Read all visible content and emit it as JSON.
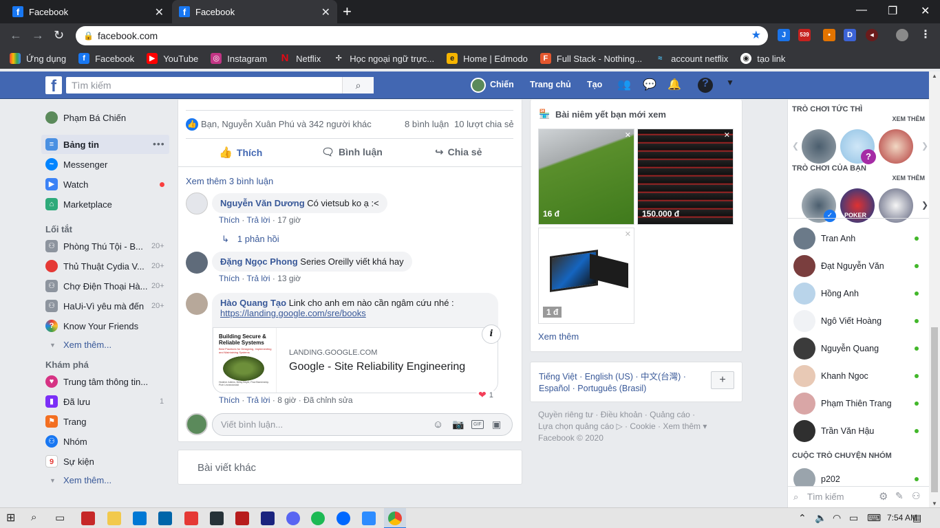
{
  "browser": {
    "tabs": [
      {
        "title": "Facebook"
      },
      {
        "title": "Facebook"
      }
    ],
    "url": "facebook.com",
    "bookmarks": [
      {
        "label": "Ứng dụng"
      },
      {
        "label": "Facebook"
      },
      {
        "label": "YouTube"
      },
      {
        "label": "Instagram"
      },
      {
        "label": "Netflix"
      },
      {
        "label": "Học ngoại ngữ trực..."
      },
      {
        "label": "Home | Edmodo"
      },
      {
        "label": "Full Stack - Nothing..."
      },
      {
        "label": "account netflix"
      },
      {
        "label": "tạo link"
      }
    ],
    "ext_badge": "539",
    "ext_d": "D"
  },
  "header": {
    "search_placeholder": "Tìm kiếm",
    "user": "Chiến",
    "home": "Trang chủ",
    "create": "Tạo"
  },
  "left": {
    "profile": "Phạm Bá Chiến",
    "main": [
      {
        "label": "Bảng tin"
      },
      {
        "label": "Messenger"
      },
      {
        "label": "Watch"
      },
      {
        "label": "Marketplace"
      }
    ],
    "shortcuts_title": "Lối tắt",
    "shortcuts": [
      {
        "label": "Phòng Thú Tội - B...",
        "count": "20+"
      },
      {
        "label": "Thủ Thuật Cydia V...",
        "count": "20+"
      },
      {
        "label": "Chợ Điện Thoại Hà...",
        "count": "20+"
      },
      {
        "label": "HaUi-Vì yêu mà đến",
        "count": "20+"
      },
      {
        "label": "Know Your Friends",
        "count": ""
      }
    ],
    "see_more": "Xem thêm...",
    "explore_title": "Khám phá",
    "explore": [
      {
        "label": "Trung tâm thông tin...",
        "count": ""
      },
      {
        "label": "Đã lưu",
        "count": "1"
      },
      {
        "label": "Trang",
        "count": ""
      },
      {
        "label": "Nhóm",
        "count": ""
      },
      {
        "label": "Sự kiện",
        "count": ""
      }
    ],
    "see_more2": "Xem thêm..."
  },
  "post": {
    "reactions": "Bạn, Nguyễn Xuân Phú và 342 người khác",
    "comments_count": "8 bình luận",
    "shares_count": "10 lượt chia sẻ",
    "like": "Thích",
    "comment": "Bình luận",
    "share": "Chia sẻ",
    "more_comments": "Xem thêm 3 bình luận",
    "comments": [
      {
        "name": "Nguyễn Văn Dương",
        "text": "Có vietsub ko ạ :<",
        "like": "Thích",
        "reply": "Trả lời",
        "time": "17 giờ"
      },
      {
        "name": "Đặng Ngọc Phong",
        "text": "Series Oreilly viết khá hay",
        "like": "Thích",
        "reply": "Trả lời",
        "time": "13 giờ"
      },
      {
        "name": "Hào Quang Tạo",
        "text": "Link cho anh em nào cần ngâm cứu nhé :",
        "link": "https://landing.google.com/sre/books",
        "like": "Thích",
        "reply": "Trả lời",
        "time": "8 giờ",
        "edited": "Đã chỉnh sửa",
        "reaction_count": "1"
      }
    ],
    "replies": "1 phản hồi",
    "preview": {
      "domain": "LANDING.GOOGLE.COM",
      "title": "Google - Site Reliability Engineering",
      "book_title": "Building Secure & Reliable Systems",
      "book_sub": "Best Practices for Designing, Implementing and Maintaining Systems",
      "book_authors": "Heather Adkins, Betsy Beyer, Paul Blankinship, Piotr Lewandowski"
    },
    "write_placeholder": "Viết bình luận...",
    "other_posts": "Bài viết khác"
  },
  "right": {
    "market_title": "Bài niêm yết bạn mới xem",
    "items": [
      {
        "price": "16 đ"
      },
      {
        "price": "150.000 đ"
      },
      {
        "price": "1 đ"
      }
    ],
    "see_more": "Xem thêm",
    "languages_line1": "Tiếng Việt · English (US) · 中文(台灣) ·",
    "languages_line2": "Español · Português (Brasil)",
    "footer1": "Quyền riêng tư · Điều khoản · Quảng cáo ·",
    "footer2": "Lựa chọn quảng cáo ▷ · Cookie · Xem thêm ▾",
    "footer3": "Facebook © 2020"
  },
  "chat": {
    "instant_games": "TRÒ CHƠI TỨC THÌ",
    "your_games": "TRÒ CHƠI CỦA BẠN",
    "see_more": "XEM THÊM",
    "poker_label": "POKER",
    "friends": [
      {
        "name": "Tran Anh"
      },
      {
        "name": "Đạt Nguyễn Văn"
      },
      {
        "name": "Hồng Anh"
      },
      {
        "name": "Ngô Viết Hoàng"
      },
      {
        "name": "Nguyễn Quang"
      },
      {
        "name": "Khanh Ngoc"
      },
      {
        "name": "Phạm Thiên Trang"
      },
      {
        "name": "Trần Văn Hậu"
      }
    ],
    "group_title": "CUỘC TRÒ CHUYỆN NHÓM",
    "group": "p202",
    "search_placeholder": "Tìm kiếm"
  },
  "taskbar": {
    "time": "7:54 AM"
  },
  "colors": {
    "fb_blue": "#4267b2",
    "link": "#385898",
    "online": "#42b72a"
  }
}
